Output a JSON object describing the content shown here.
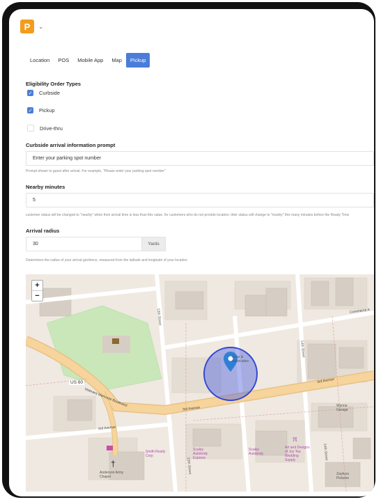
{
  "app": {
    "logo_letter": "P"
  },
  "tabs": [
    {
      "label": "Location",
      "active": false
    },
    {
      "label": "POS",
      "active": false
    },
    {
      "label": "Mobile App",
      "active": false
    },
    {
      "label": "Map",
      "active": false
    },
    {
      "label": "Pickup",
      "active": true
    }
  ],
  "eligibility": {
    "title": "Eligibility Order Types",
    "options": [
      {
        "label": "Curbside",
        "checked": true
      },
      {
        "label": "Pickup",
        "checked": true
      },
      {
        "label": "Drive-thru",
        "checked": false
      }
    ]
  },
  "curbside": {
    "title": "Curbside arrival information prompt",
    "value": "Enter your parking spot number",
    "helper": "Prompt shown to guest after arrival. For example, \"Please enter your parking spot number\""
  },
  "nearby": {
    "title": "Nearby minutes",
    "value": "5",
    "helper": "customer status will be changed to \"nearby\" when their arrival time is less than this value. for customers who do not provide location, their status will change to \"nearby\" this many minutes before the Ready Time"
  },
  "radius": {
    "title": "Arrival radius",
    "value": "30",
    "unit": "Yards",
    "helper": "Determines the radius of your arrival geofence, measured from the latitude and longitude of your location."
  },
  "map": {
    "zoom_in": "+",
    "zoom_out": "−",
    "labels": {
      "street_13th_a": "13th Street",
      "street_13th_b": "13th Street",
      "street_14th_a": "14th Street",
      "street_14th_b": "14th Street",
      "street_15th": "15th Street",
      "third_ave_a": "3rd Avenue",
      "third_ave_b": "3rd Avenue",
      "third_ave_c": "3rd Avenue",
      "veterans": "Veterans Memorial Boulevard",
      "us60": "US 60",
      "commerce": "Commerce A",
      "marker_poi": "Sons & Associates",
      "wvzm": "Wynne Garage",
      "zephyr": "Zephyrs Pictures",
      "alpha_chapel": "Anderson Army Chapel",
      "poi1": "Scaley Autobody Express",
      "poi2": "Scaley Autobody",
      "poi3": "Art and Designs of Joy Tea Wedding Supply",
      "poi4": "Smith Realty Corp"
    },
    "colors": {
      "radius_fill": "#4d62e0",
      "marker": "#2f7fd6",
      "park": "#c9e7b8",
      "road_major": "#f6d49b"
    }
  }
}
